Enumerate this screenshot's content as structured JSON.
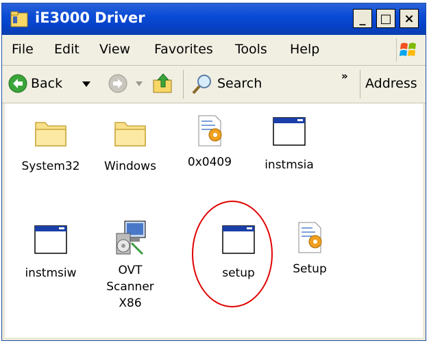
{
  "window": {
    "title": "iE3000 Driver"
  },
  "titlebar_buttons": {
    "minimize": "_",
    "maximize": "□",
    "close": "×"
  },
  "menu": [
    "File",
    "Edit",
    "View",
    "Favorites",
    "Tools",
    "Help"
  ],
  "toolbar": {
    "back_label": "Back",
    "search_label": "Search",
    "overflow_glyph": "»",
    "address_label": "Address"
  },
  "files": [
    {
      "name": "System32",
      "type": "folder",
      "icon": "folder-icon"
    },
    {
      "name": "Windows",
      "type": "folder",
      "icon": "folder-icon"
    },
    {
      "name": "0x0409",
      "type": "settings-file",
      "icon": "config-file-icon"
    },
    {
      "name": "instmsia",
      "type": "application",
      "icon": "application-window-icon"
    },
    {
      "name": "instmsiw",
      "type": "application",
      "icon": "application-window-icon"
    },
    {
      "name": "OVT Scanner X86",
      "type": "installer",
      "icon": "installer-icon",
      "label_lines": [
        "OVT",
        "Scanner",
        "X86"
      ]
    },
    {
      "name": "setup",
      "type": "application",
      "icon": "application-window-icon",
      "highlighted": true
    },
    {
      "name": "Setup",
      "type": "settings-file",
      "icon": "config-file-icon"
    }
  ],
  "annotation": {
    "color": "#e00000",
    "target": "setup"
  }
}
